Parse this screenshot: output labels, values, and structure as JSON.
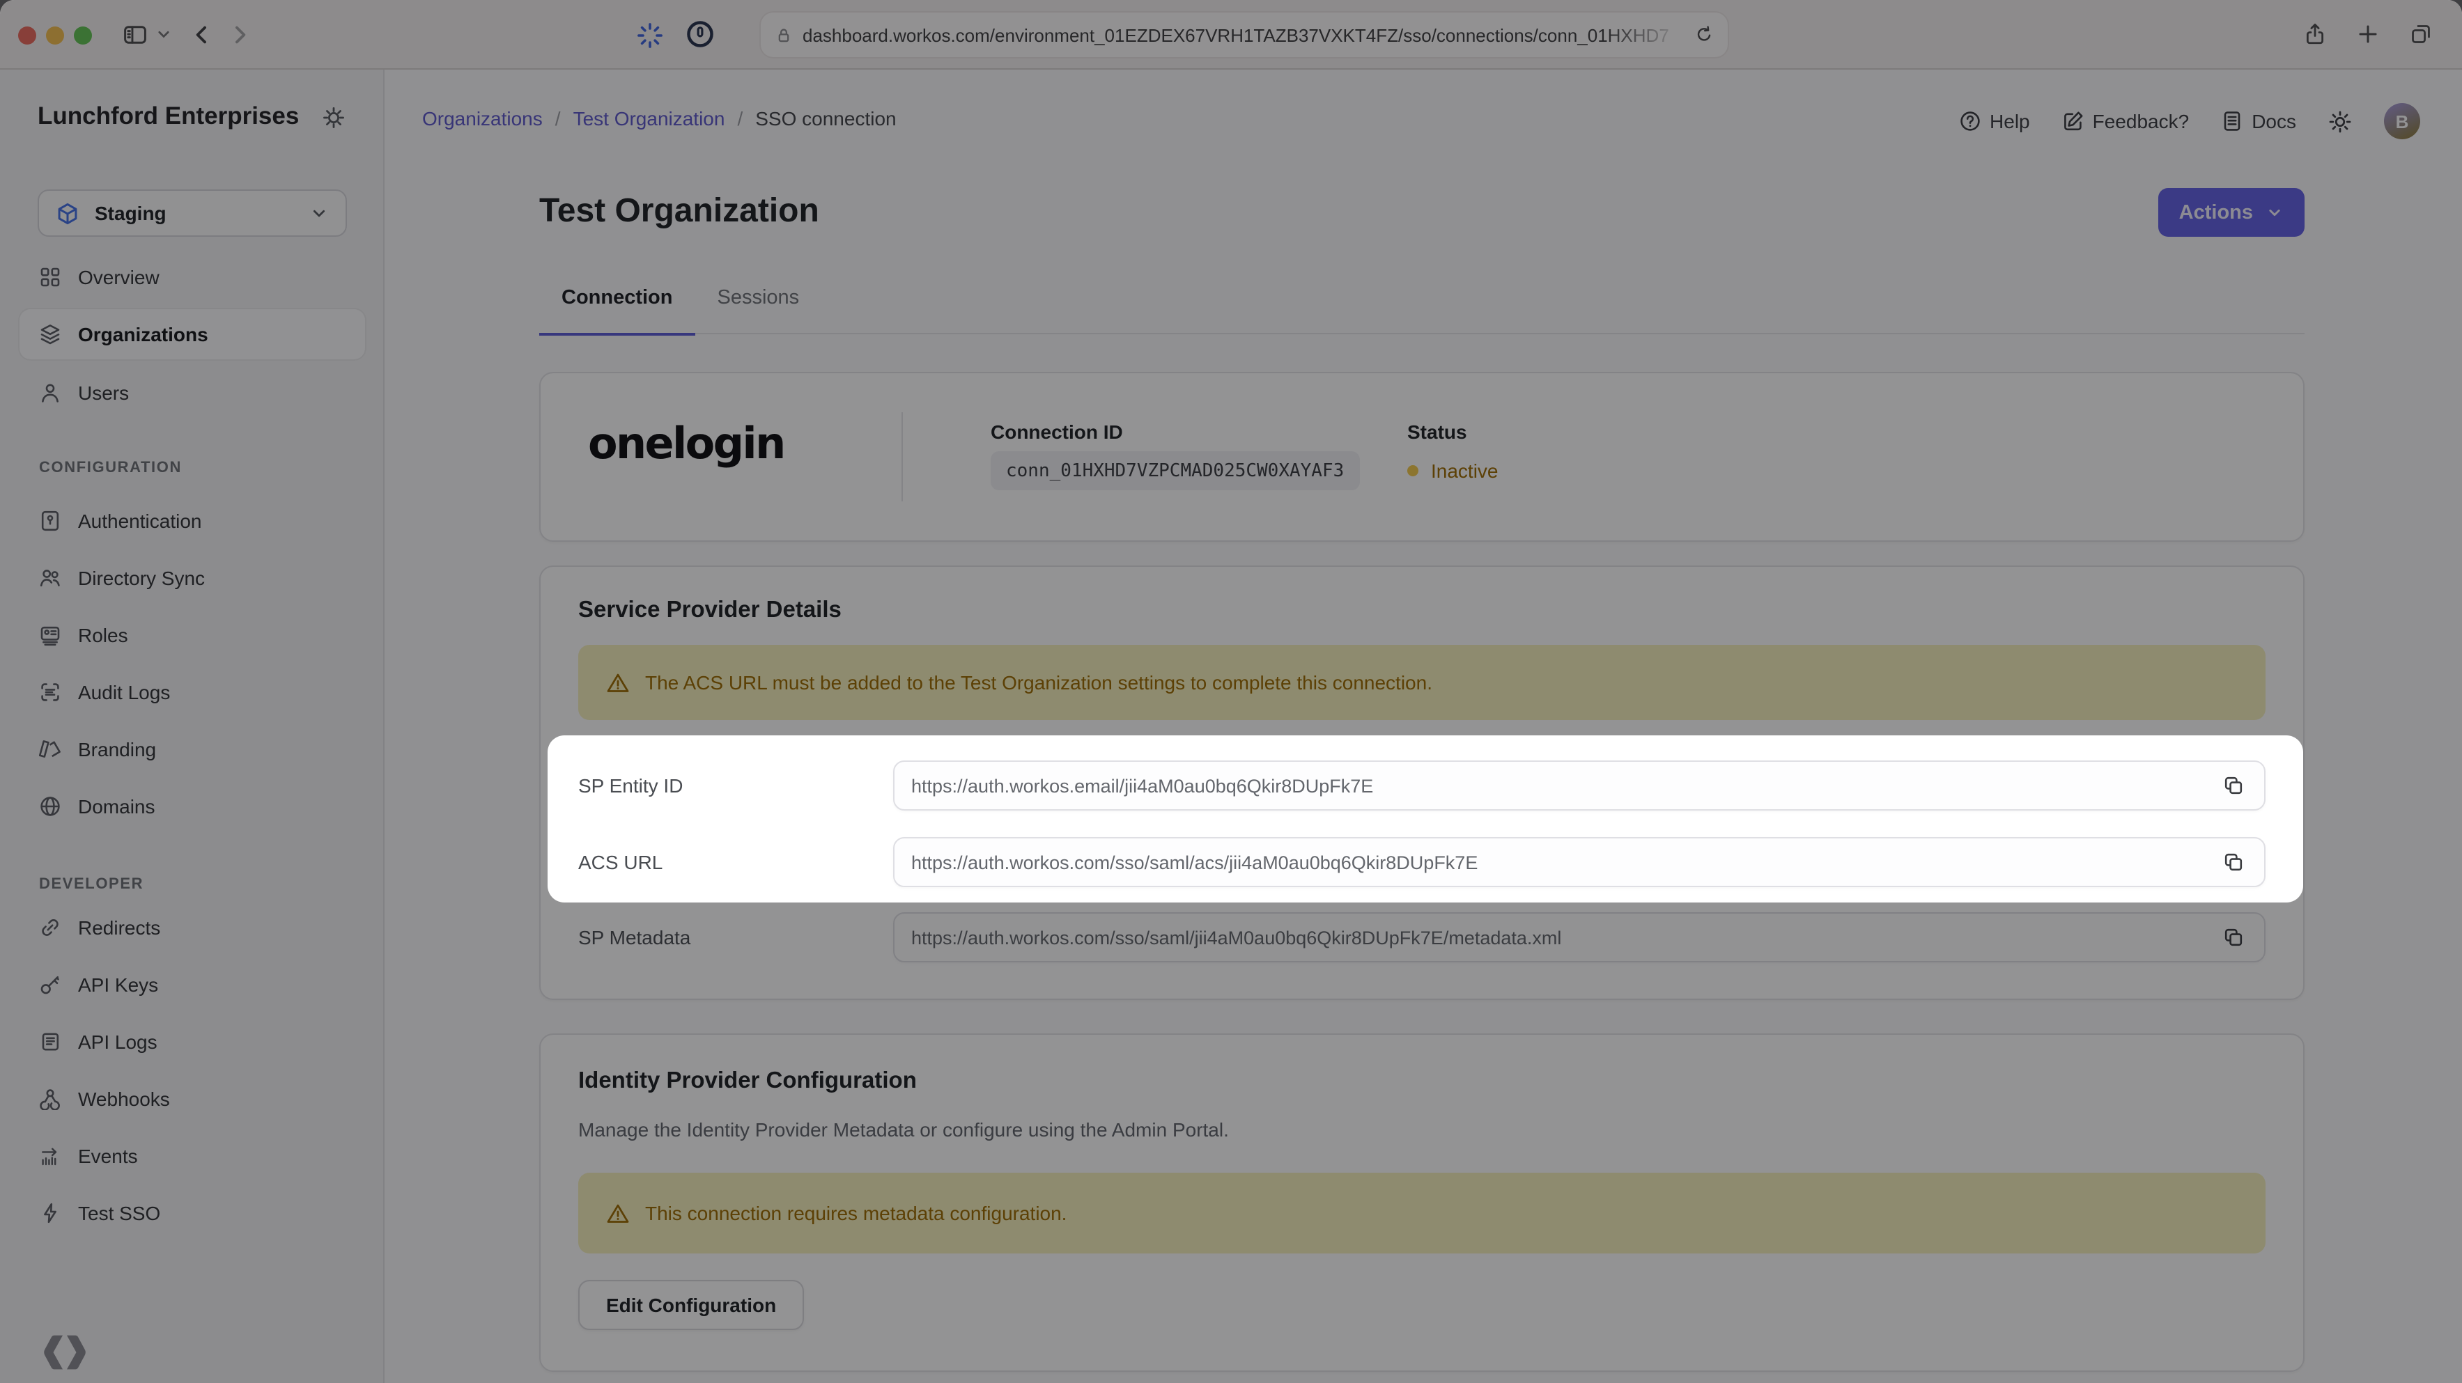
{
  "browser": {
    "url": "dashboard.workos.com/environment_01EZDEX67VRH1TAZB37VXKT4FZ/sso/connections/conn_01HXHD7"
  },
  "sidebar": {
    "org_name": "Lunchford Enterprises",
    "environment": "Staging",
    "nav": [
      "Overview",
      "Organizations",
      "Users"
    ],
    "section1_label": "CONFIGURATION",
    "config": [
      "Authentication",
      "Directory Sync",
      "Roles",
      "Audit Logs",
      "Branding",
      "Domains"
    ],
    "section2_label": "DEVELOPER",
    "developer": [
      "Redirects",
      "API Keys",
      "API Logs",
      "Webhooks",
      "Events",
      "Test SSO"
    ]
  },
  "header": {
    "breadcrumb": [
      "Organizations",
      "Test Organization",
      "SSO connection"
    ],
    "help": "Help",
    "feedback": "Feedback?",
    "docs": "Docs",
    "avatar_initial": "B"
  },
  "page": {
    "title": "Test Organization",
    "actions": "Actions",
    "tabs": [
      "Connection",
      "Sessions"
    ]
  },
  "connection": {
    "provider": "onelogin",
    "id_label": "Connection ID",
    "id": "conn_01HXHD7VZPCMAD025CW0XAYAF3",
    "status_label": "Status",
    "status": "Inactive"
  },
  "sp": {
    "heading": "Service Provider Details",
    "warning": "The ACS URL must be added to the Test Organization settings to complete this connection.",
    "rows": [
      {
        "label": "SP Entity ID",
        "value": "https://auth.workos.email/jii4aM0au0bq6Qkir8DUpFk7E"
      },
      {
        "label": "ACS URL",
        "value": "https://auth.workos.com/sso/saml/acs/jii4aM0au0bq6Qkir8DUpFk7E"
      },
      {
        "label": "SP Metadata",
        "value": "https://auth.workos.com/sso/saml/jii4aM0au0bq6Qkir8DUpFk7E/metadata.xml"
      }
    ]
  },
  "idp": {
    "heading": "Identity Provider Configuration",
    "description": "Manage the Identity Provider Metadata or configure using the Admin Portal.",
    "warning": "This connection requires metadata configuration.",
    "button": "Edit Configuration"
  },
  "colors": {
    "accent": "#6360E4",
    "link": "#5D58CC",
    "amber_text": "#9E6C00",
    "amber_bg": "#F7F0BE",
    "status_dot": "#F2C94C"
  }
}
